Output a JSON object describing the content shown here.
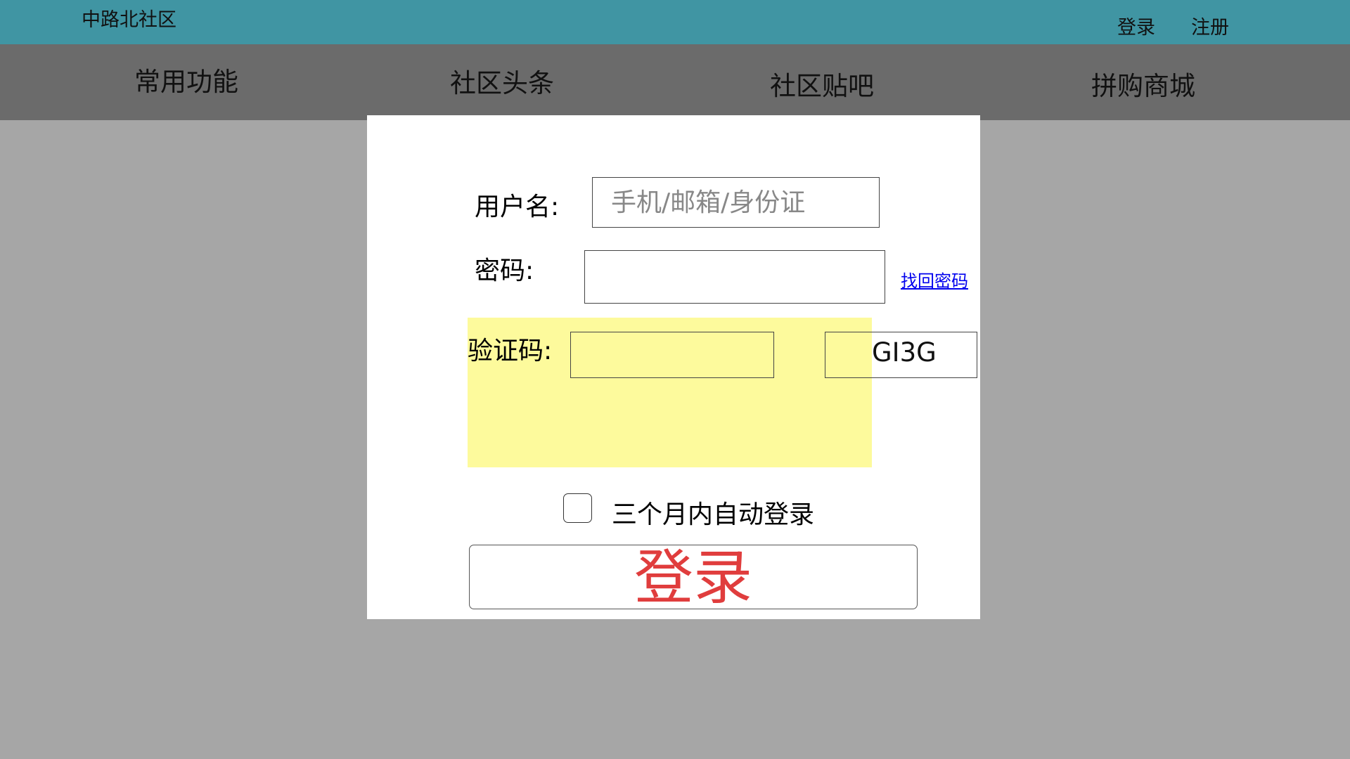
{
  "header": {
    "site_title": "中路北社区",
    "links": {
      "login": "登录",
      "register": "注册"
    }
  },
  "nav": {
    "items": [
      "常用功能",
      "社区头条",
      "社区贴吧",
      "拼购商城"
    ]
  },
  "login_form": {
    "username_label": "用户名:",
    "username_placeholder": "手机/邮箱/身份证",
    "password_label": "密码:",
    "password_value": "",
    "forgot_password": "找回密码",
    "captcha_label": "验证码:",
    "captcha_value": "",
    "captcha_code": "GI3G",
    "remember_label": "三个月内自动登录",
    "remember_checked": false,
    "submit_label": "登录"
  },
  "colors": {
    "topbar": "#4095a3",
    "navbar": "#6b6b6b",
    "background": "#a6a6a6",
    "highlight": "#fdfa9c",
    "submit_text": "#e03d3d",
    "link": "#0000ee"
  }
}
